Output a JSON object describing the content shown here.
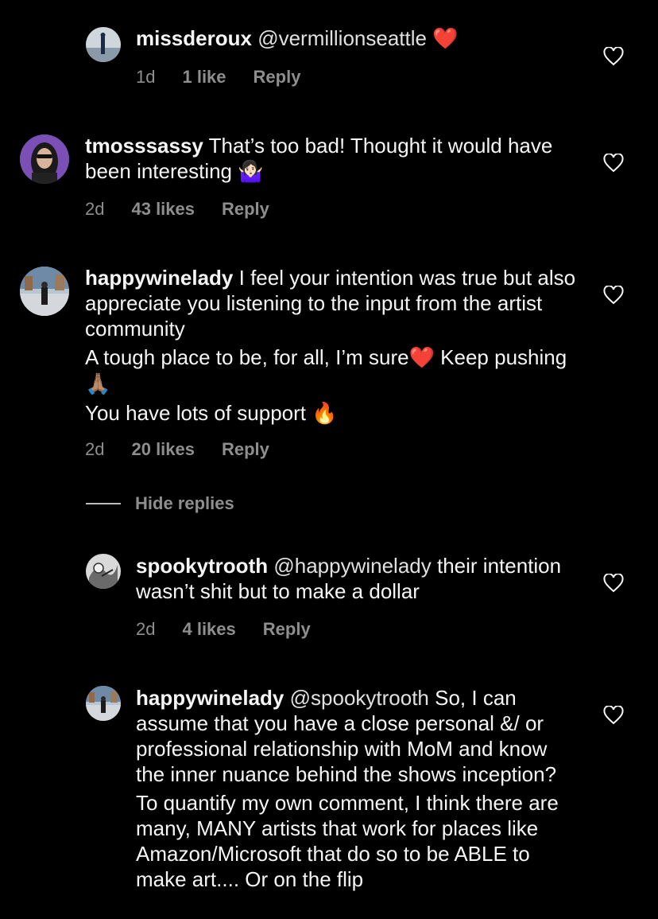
{
  "comments": [
    {
      "username": "missderoux",
      "mention": "@vermillionseattle",
      "text": "",
      "emoji": "❤️",
      "time": "1d",
      "likes": "1 like",
      "reply": "Reply"
    },
    {
      "username": "tmosssassy",
      "text": "That’s too bad! Thought it would have been interesting",
      "emoji": "🤷🏻‍♀️",
      "time": "2d",
      "likes": "43 likes",
      "reply": "Reply"
    },
    {
      "username": "happywinelady",
      "text_line1": "I feel your intention was true but also appreciate you listening to the input from the artist community",
      "text_line2": "A tough place to be, for all, I’m sure",
      "emoji_heart": "❤️",
      "text_line3": " Keep pushing",
      "emoji_pray": "🙏🏽",
      "text_line4": "You have lots of support",
      "emoji_fire": "🔥",
      "time": "2d",
      "likes": "20 likes",
      "reply": "Reply"
    },
    {
      "username": "spookytrooth",
      "mention": "@happywinelady",
      "text": "their intention wasn’t shit but to make a dollar",
      "time": "2d",
      "likes": "4 likes",
      "reply": "Reply"
    },
    {
      "username": "happywinelady",
      "mention": "@spookytrooth",
      "text_line1": "So, I can assume that you have a close personal &/ or professional relationship with MoM and know the inner nuance behind the shows inception?",
      "text_line2": "To quantify my own comment, I think there are many, MANY artists that work for places like Amazon/Microsoft that do so to be ABLE to make art.... Or on the flip"
    }
  ],
  "hide_replies": "Hide replies",
  "colors": {
    "background": "#000000",
    "text": "#f5f5f5",
    "meta": "#8e8e8e",
    "heart_red": "#e0243a"
  }
}
